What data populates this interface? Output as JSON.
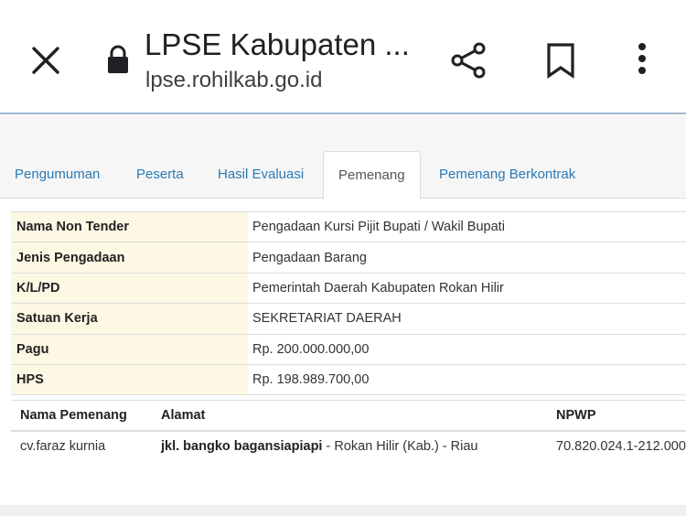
{
  "browser": {
    "title": "LPSE Kabupaten ...",
    "url": "lpse.rohilkab.go.id",
    "icons": {
      "close": "close-icon",
      "lock": "lock-icon",
      "share": "share-icon",
      "bookmark": "bookmark-icon",
      "more": "more-vert-icon"
    }
  },
  "tabs": [
    {
      "label": "Pengumuman"
    },
    {
      "label": "Peserta"
    },
    {
      "label": "Hasil Evaluasi"
    },
    {
      "label": "Pemenang",
      "active": true
    },
    {
      "label": "Pemenang Berkontrak"
    }
  ],
  "info": [
    {
      "key": "Nama Non Tender",
      "value": "Pengadaan Kursi Pijit Bupati / Wakil Bupati"
    },
    {
      "key": "Jenis Pengadaan",
      "value": "Pengadaan Barang"
    },
    {
      "key": "K/L/PD",
      "value": "Pemerintah Daerah Kabupaten Rokan Hilir"
    },
    {
      "key": "Satuan Kerja",
      "value": "SEKRETARIAT DAERAH"
    },
    {
      "key": "Pagu",
      "value": "Rp. 200.000.000,00"
    },
    {
      "key": "HPS",
      "value": "Rp. 198.989.700,00"
    }
  ],
  "winner_table": {
    "headers": [
      "Nama Pemenang",
      "Alamat",
      "NPWP"
    ],
    "rows": [
      {
        "name": "cv.faraz kurnia",
        "address_bold": "jkl. bangko bagansiapiapi",
        "address_rest": " - Rokan Hilir (Kab.) - Riau",
        "npwp": "70.820.024.1-212.000"
      }
    ]
  },
  "colors": {
    "link": "#2a7ab5",
    "label_bg": "#fcf8e3",
    "border": "#dddddd"
  }
}
